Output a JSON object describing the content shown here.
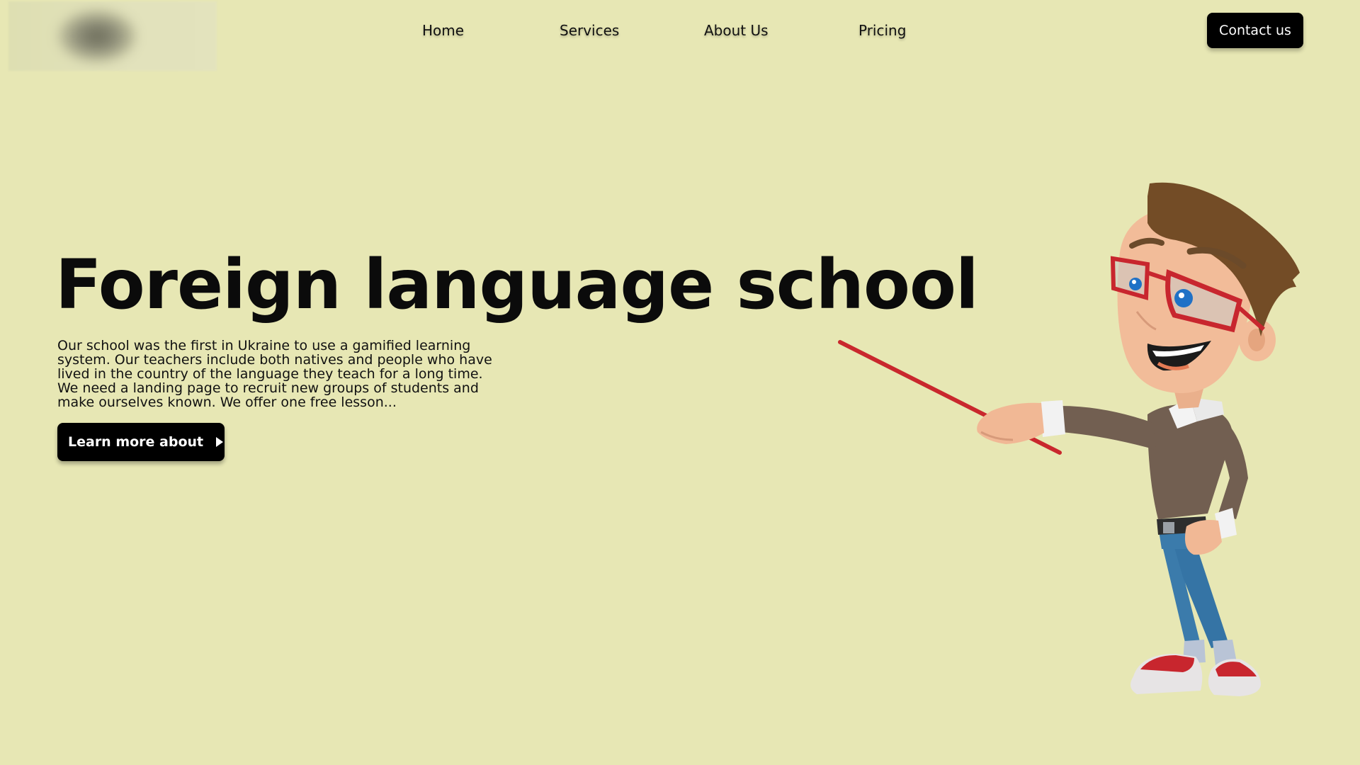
{
  "header": {
    "logo_icon": "blurred-logo",
    "nav": {
      "home": "Home",
      "services": "Services",
      "about": "About Us",
      "pricing": "Pricing"
    },
    "contact_label": "Contact us"
  },
  "hero": {
    "title": "Foreign language school",
    "description": "Our school was the first in Ukraine to use a gamified learning system. Our teachers include both natives and people who have lived in the country of the language they teach for a long time. We need a landing page to recruit new groups of students and make ourselves known. We offer one free lesson...",
    "cta_label": "Learn more about",
    "cta_icon": "play-triangle-icon"
  },
  "illustration": {
    "icon": "teacher-with-pointer-illustration"
  },
  "colors": {
    "background": "#e7e7b4",
    "button": "#000000",
    "button_text": "#ffffff",
    "pointer": "#c9282d"
  }
}
